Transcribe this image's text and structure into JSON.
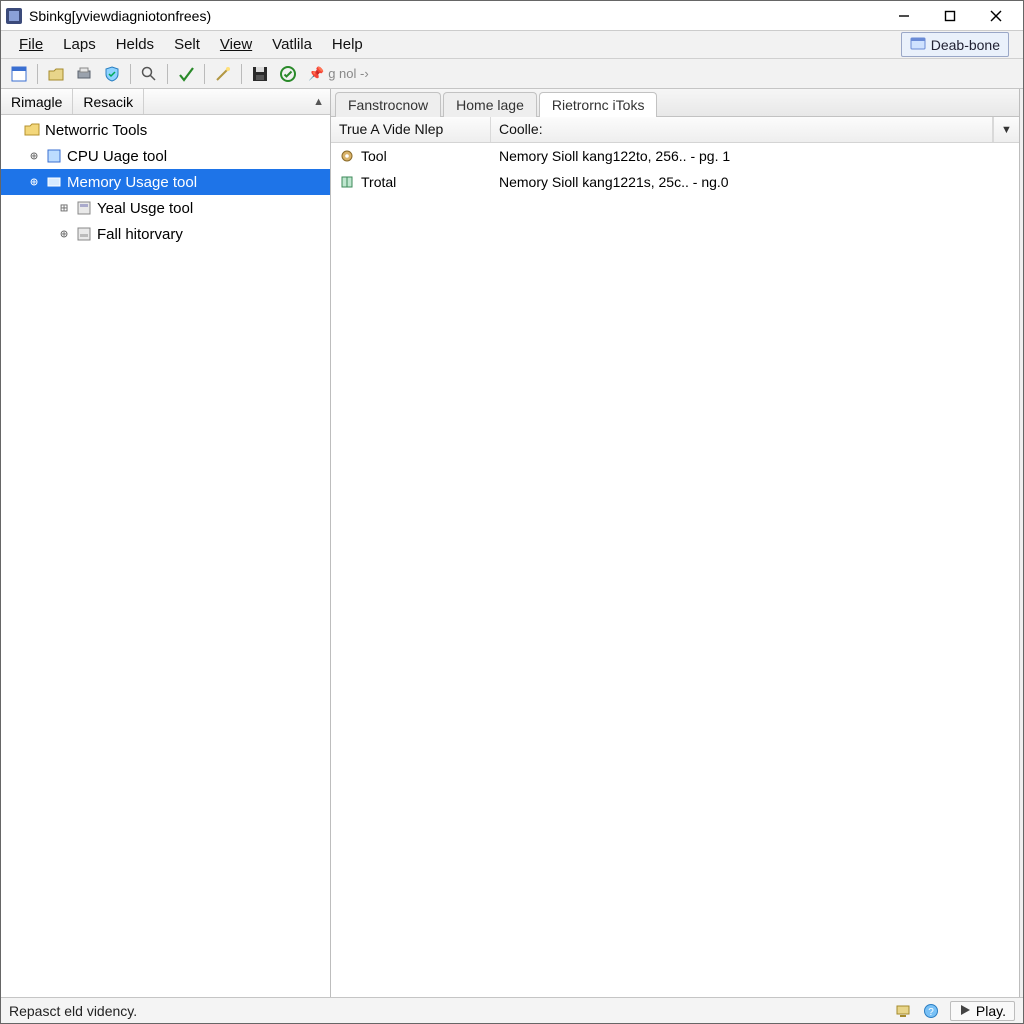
{
  "titlebar": {
    "title": "Sbinkg[yviewdiagniotonfrees)"
  },
  "menubar": {
    "items": [
      "File",
      "Laps",
      "Helds",
      "Selt",
      "View",
      "Vatlila",
      "Help"
    ],
    "deab_button": "Deab-bone"
  },
  "toolbar": {
    "hint": "g nol  -›"
  },
  "left": {
    "tabs": [
      "Rimagle",
      "Resacik"
    ],
    "root": "Networric Tools",
    "items": [
      {
        "label": "CPU Uage tool",
        "selected": false,
        "depth": 2
      },
      {
        "label": "Memory Usage tool",
        "selected": true,
        "depth": 2
      },
      {
        "label": "Yeal Usge tool",
        "selected": false,
        "depth": 3
      },
      {
        "label": "Fall hitorvary",
        "selected": false,
        "depth": 3
      }
    ]
  },
  "right": {
    "tabs": [
      {
        "label": "Fanstrocnow",
        "active": false
      },
      {
        "label": "Home lage",
        "active": false
      },
      {
        "label": "Rietrornc iToks",
        "active": true
      }
    ],
    "columns": [
      "True A Vide Nlep",
      "Coolle:"
    ],
    "rows": [
      {
        "a": "Tool",
        "b": "Nemory Sioll kang122to, 256.. - pg. 1"
      },
      {
        "a": "Trotal",
        "b": "Nemory Sioll kang1221s, 25c.. - ng.0"
      }
    ]
  },
  "statusbar": {
    "text": "Repasct eld vidency.",
    "play": "Play."
  }
}
